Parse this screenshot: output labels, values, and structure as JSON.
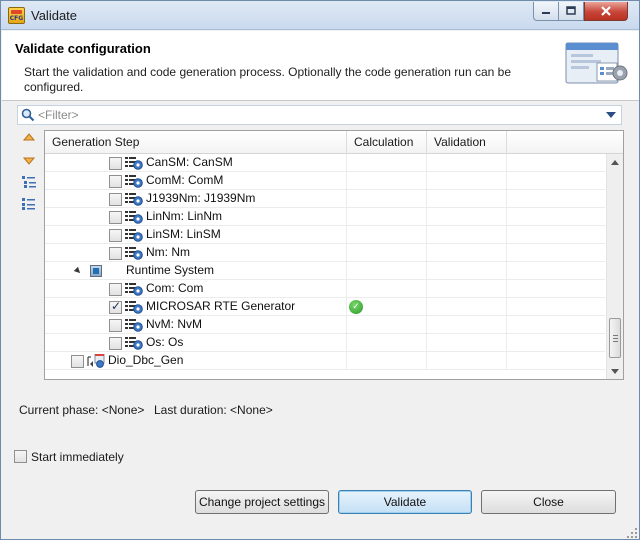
{
  "window": {
    "title": "Validate",
    "app_icon_text": "CFG"
  },
  "header": {
    "title": "Validate configuration",
    "description": "Start the validation and code generation process. Optionally the code generation run can be configured."
  },
  "filter": {
    "placeholder": "<Filter>",
    "value": ""
  },
  "toolbar": {
    "items": [
      {
        "icon": "move-up-icon"
      },
      {
        "icon": "move-down-icon"
      },
      {
        "icon": "expand-all-icon"
      },
      {
        "icon": "collapse-all-icon"
      }
    ]
  },
  "table": {
    "columns": [
      "Generation Step",
      "Calculation",
      "Validation"
    ],
    "rows": [
      {
        "label": "CanSM: CanSM",
        "checked": false,
        "calculation": ""
      },
      {
        "label": "ComM: ComM",
        "checked": false,
        "calculation": ""
      },
      {
        "label": "J1939Nm: J1939Nm",
        "checked": false,
        "calculation": ""
      },
      {
        "label": "LinNm: LinNm",
        "checked": false,
        "calculation": ""
      },
      {
        "label": "LinSM: LinSM",
        "checked": false,
        "calculation": ""
      },
      {
        "label": "Nm: Nm",
        "checked": false,
        "calculation": ""
      },
      {
        "label": "Runtime System",
        "group": true,
        "expanded": true
      },
      {
        "label": "Com: Com",
        "checked": false,
        "calculation": ""
      },
      {
        "label": "MICROSAR RTE Generator",
        "checked": true,
        "calculation": "ok"
      },
      {
        "label": "NvM: NvM",
        "checked": false,
        "calculation": ""
      },
      {
        "label": "Os: Os",
        "checked": false,
        "calculation": ""
      },
      {
        "label": "Dio_Dbc_Gen",
        "checked": false,
        "calculation": "",
        "top_level": true
      }
    ]
  },
  "status": {
    "current_phase": "Current phase: <None>",
    "last_duration": "Last duration: <None>"
  },
  "options": {
    "start_immediately_label": "Start immediately",
    "start_immediately_checked": false
  },
  "buttons": {
    "change_settings": "Change project settings",
    "validate": "Validate",
    "close": "Close"
  },
  "colors": {
    "accent": "#3c7fb1",
    "ok_green": "#2a9a2a"
  }
}
